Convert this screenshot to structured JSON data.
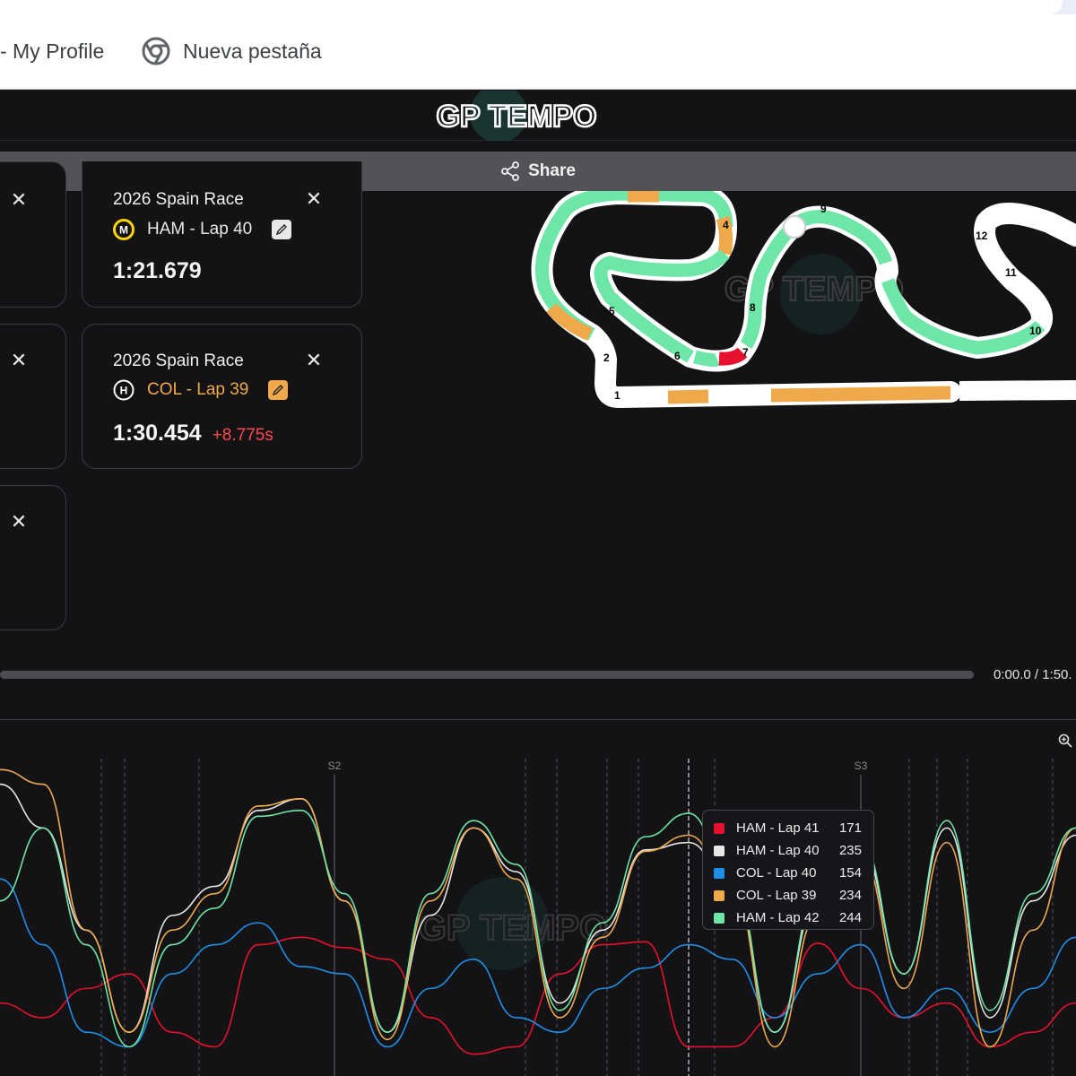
{
  "browser": {
    "tabs": [
      {
        "label": "- My Profile"
      },
      {
        "label": "Nueva pestaña",
        "icon": "chrome-icon"
      }
    ]
  },
  "app": {
    "logo_text": "GP TEMPO",
    "share_label": "Share",
    "share_icon": "share-icon"
  },
  "cards": [
    {
      "session": "2026 Spain Race",
      "driver_label": "HAM - Lap 40",
      "lap_time": "1:21.679",
      "delta": "",
      "team_icon": "mercedes-logo-icon",
      "accent": "#e8e8e8",
      "badge_color": "#ffd400"
    },
    {
      "session": "2026 Spain Race",
      "driver_label": "COL - Lap 39",
      "lap_time": "1:30.454",
      "delta": "+8.775s",
      "team_icon": "haas-logo-icon",
      "accent": "#f0a94a",
      "badge_color": "#ffffff"
    }
  ],
  "track_map": {
    "turn_labels": [
      "1",
      "2",
      "4",
      "5",
      "6",
      "7",
      "8",
      "9",
      "10",
      "11",
      "12"
    ],
    "watermark": "GP TEMPO"
  },
  "playback": {
    "time_display": "0:00.0 / 1:50."
  },
  "chart_data": {
    "type": "line",
    "title": "",
    "ylabel": "",
    "xlabel": "",
    "sector_labels": [
      "S2",
      "S3"
    ],
    "watermark": "GP TEMPO",
    "x": [
      0,
      4,
      8,
      12,
      16,
      20,
      24,
      28,
      32,
      36,
      40,
      44,
      48,
      52,
      56,
      60,
      64,
      68,
      72,
      76,
      80,
      84,
      88,
      92,
      96,
      100
    ],
    "series": [
      {
        "name": "HAM - Lap 41",
        "color": "#e8112d",
        "values": [
          130,
          120,
          140,
          150,
          110,
          100,
          170,
          175,
          168,
          160,
          120,
          95,
          100,
          150,
          170,
          172,
          100,
          100,
          120,
          171,
          140,
          120,
          130,
          100,
          110,
          130
        ]
      },
      {
        "name": "HAM - Lap 40",
        "color": "#e8e8e8",
        "values": [
          280,
          250,
          180,
          110,
          190,
          210,
          262,
          270,
          200,
          110,
          190,
          250,
          220,
          130,
          180,
          235,
          240,
          210,
          110,
          200,
          235,
          150,
          250,
          120,
          200,
          245
        ]
      },
      {
        "name": "COL - Lap 40",
        "color": "#1e90e8",
        "values": [
          215,
          170,
          110,
          100,
          150,
          170,
          185,
          155,
          150,
          100,
          140,
          160,
          120,
          110,
          140,
          154,
          170,
          160,
          120,
          150,
          170,
          120,
          140,
          110,
          140,
          175
        ]
      },
      {
        "name": "COL - Lap 39",
        "color": "#f0a94a",
        "values": [
          290,
          280,
          180,
          110,
          180,
          205,
          265,
          270,
          200,
          105,
          200,
          250,
          215,
          120,
          175,
          234,
          245,
          210,
          100,
          190,
          230,
          140,
          240,
          100,
          180,
          250
        ]
      },
      {
        "name": "HAM - Lap 42",
        "color": "#6ee6a8",
        "values": [
          200,
          250,
          170,
          100,
          170,
          195,
          258,
          262,
          205,
          110,
          205,
          255,
          225,
          125,
          185,
          244,
          260,
          215,
          110,
          205,
          240,
          150,
          255,
          125,
          205,
          250
        ]
      }
    ],
    "tooltip": [
      {
        "name": "HAM - Lap 41",
        "value": "171",
        "color": "#e8112d"
      },
      {
        "name": "HAM - Lap 40",
        "value": "235",
        "color": "#e8e8e8"
      },
      {
        "name": "COL - Lap 40",
        "value": "154",
        "color": "#1e90e8"
      },
      {
        "name": "COL - Lap 39",
        "value": "234",
        "color": "#f0a94a"
      },
      {
        "name": "HAM - Lap 42",
        "value": "244",
        "color": "#6ee6a8"
      }
    ]
  }
}
